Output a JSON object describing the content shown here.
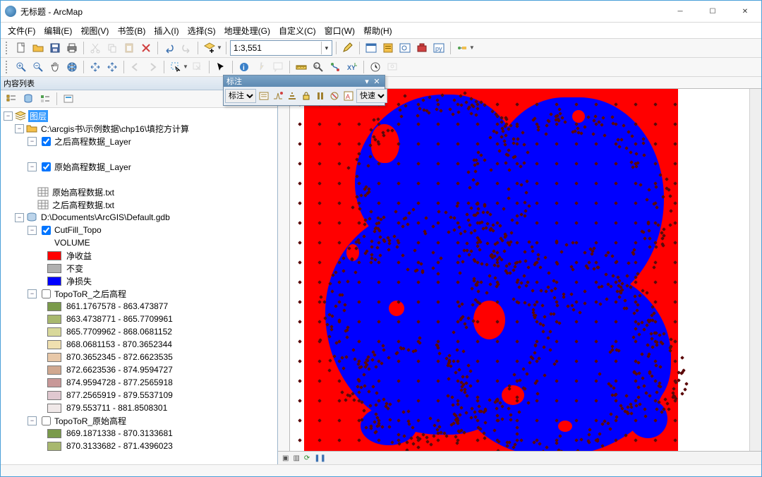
{
  "window": {
    "title": "无标题 - ArcMap"
  },
  "menubar": [
    "文件(F)",
    "编辑(E)",
    "视图(V)",
    "书签(B)",
    "插入(I)",
    "选择(S)",
    "地理处理(G)",
    "自定义(C)",
    "窗口(W)",
    "帮助(H)"
  ],
  "scale": "1:3,551",
  "toc": {
    "title": "内容列表",
    "root": "图层",
    "group1_path": "C:\\arcgis书\\示例数据\\chp16\\填挖方计算",
    "layer_after": "之后高程数据_Layer",
    "layer_before": "原始高程数据_Layer",
    "txt_before": "原始高程数据.txt",
    "txt_after": "之后高程数据.txt",
    "gdb_path": "D:\\Documents\\ArcGIS\\Default.gdb",
    "cutfill": "CutFill_Topo",
    "cutfill_field": "VOLUME",
    "cutfill_classes": [
      {
        "color": "#ff0000",
        "label": "净收益"
      },
      {
        "color": "#b0b0b0",
        "label": "不变"
      },
      {
        "color": "#0000ff",
        "label": "净损失"
      }
    ],
    "topo_after": "TopoToR_之后高程",
    "topo_after_classes": [
      {
        "color": "#7a9a4a",
        "label": "861.1767578 - 863.473877"
      },
      {
        "color": "#a8b86e",
        "label": "863.4738771 - 865.7709961"
      },
      {
        "color": "#d8d89a",
        "label": "865.7709962 - 868.0681152"
      },
      {
        "color": "#f0e0b0",
        "label": "868.0681153 - 870.3652344"
      },
      {
        "color": "#e8c8a8",
        "label": "870.3652345 - 872.6623535"
      },
      {
        "color": "#d0a890",
        "label": "872.6623536 - 874.9594727"
      },
      {
        "color": "#c89898",
        "label": "874.9594728 - 877.2565918"
      },
      {
        "color": "#e0c8d0",
        "label": "877.2565919 - 879.5537109"
      },
      {
        "color": "#f0e8e8",
        "label": "879.553711 - 881.8508301"
      }
    ],
    "topo_before": "TopoToR_原始高程",
    "topo_before_classes": [
      {
        "color": "#7a9a4a",
        "label": "869.1871338 - 870.3133681"
      },
      {
        "color": "#a8b86e",
        "label": "870.3133682 - 871.4396023"
      }
    ]
  },
  "float": {
    "title": "标注",
    "dropdown1": "标注",
    "dropdown2": "快速"
  }
}
